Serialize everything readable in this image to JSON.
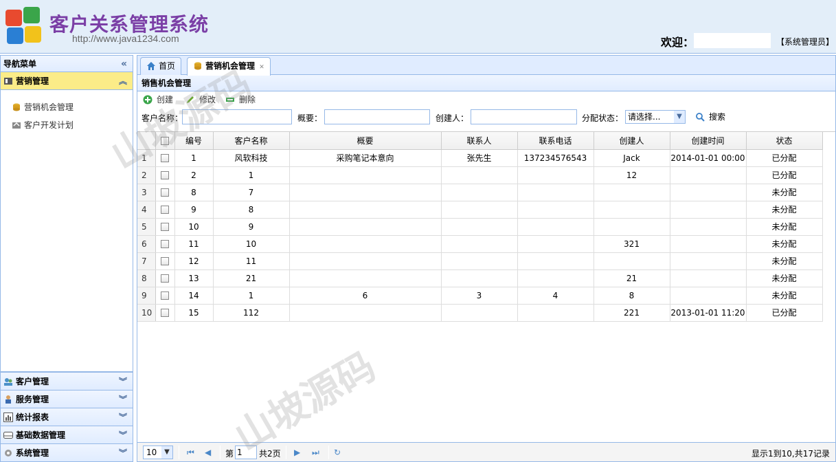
{
  "header": {
    "title": "客户关系管理系统",
    "url": "http://www.java1234.com",
    "welcome": "欢迎：",
    "role": "【系统管理员】"
  },
  "sidebar": {
    "title": "导航菜单",
    "active_section": {
      "label": "营销管理",
      "items": [
        {
          "label": "营销机会管理",
          "icon": "coins-icon"
        },
        {
          "label": "客户开发计划",
          "icon": "plan-icon"
        }
      ]
    },
    "sections": [
      {
        "label": "客户管理",
        "icon": "users-icon"
      },
      {
        "label": "服务管理",
        "icon": "service-icon"
      },
      {
        "label": "统计报表",
        "icon": "chart-icon"
      },
      {
        "label": "基础数据管理",
        "icon": "database-icon"
      },
      {
        "label": "系统管理",
        "icon": "gear-icon"
      }
    ]
  },
  "tabs": [
    {
      "label": "首页",
      "icon": "home-icon"
    },
    {
      "label": "营销机会管理",
      "icon": "coins-icon"
    }
  ],
  "panel": {
    "title": "销售机会管理"
  },
  "toolbar": {
    "create": "创建",
    "edit": "修改",
    "delete": "删除"
  },
  "search": {
    "customer_label": "客户名称：",
    "summary_label": "概要：",
    "creator_label": "创建人：",
    "status_label": "分配状态：",
    "status_value": "请选择...",
    "search_button": "搜索"
  },
  "grid": {
    "columns": [
      "编号",
      "客户名称",
      "概要",
      "联系人",
      "联系电话",
      "创建人",
      "创建时间",
      "状态"
    ],
    "rows": [
      [
        "1",
        "1",
        "风软科技",
        "采购笔记本意向",
        "张先生",
        "137234576543",
        "Jack",
        "2014-01-01 00:00",
        "已分配"
      ],
      [
        "2",
        "2",
        "1",
        "",
        "",
        "",
        "12",
        "",
        "已分配"
      ],
      [
        "3",
        "8",
        "7",
        "",
        "",
        "",
        "",
        "",
        "未分配"
      ],
      [
        "4",
        "9",
        "8",
        "",
        "",
        "",
        "",
        "",
        "未分配"
      ],
      [
        "5",
        "10",
        "9",
        "",
        "",
        "",
        "",
        "",
        "未分配"
      ],
      [
        "6",
        "11",
        "10",
        "",
        "",
        "",
        "321",
        "",
        "未分配"
      ],
      [
        "7",
        "12",
        "11",
        "",
        "",
        "",
        "",
        "",
        "未分配"
      ],
      [
        "8",
        "13",
        "21",
        "",
        "",
        "",
        "21",
        "",
        "未分配"
      ],
      [
        "9",
        "14",
        "1",
        "6",
        "3",
        "4",
        "8",
        "",
        "未分配"
      ],
      [
        "10",
        "15",
        "112",
        "",
        "",
        "",
        "221",
        "2013-01-01 11:20",
        "已分配"
      ]
    ]
  },
  "pager": {
    "page_size": "10",
    "page_prefix": "第",
    "page_value": "1",
    "page_total": "共2页",
    "info": "显示1到10,共17记录"
  },
  "watermark": "山坡源码",
  "colors": {
    "border": "#95b8e7",
    "header_bg": "#e3eef9",
    "active_section": "#fbec88",
    "title_purple": "#7b3fa6"
  }
}
